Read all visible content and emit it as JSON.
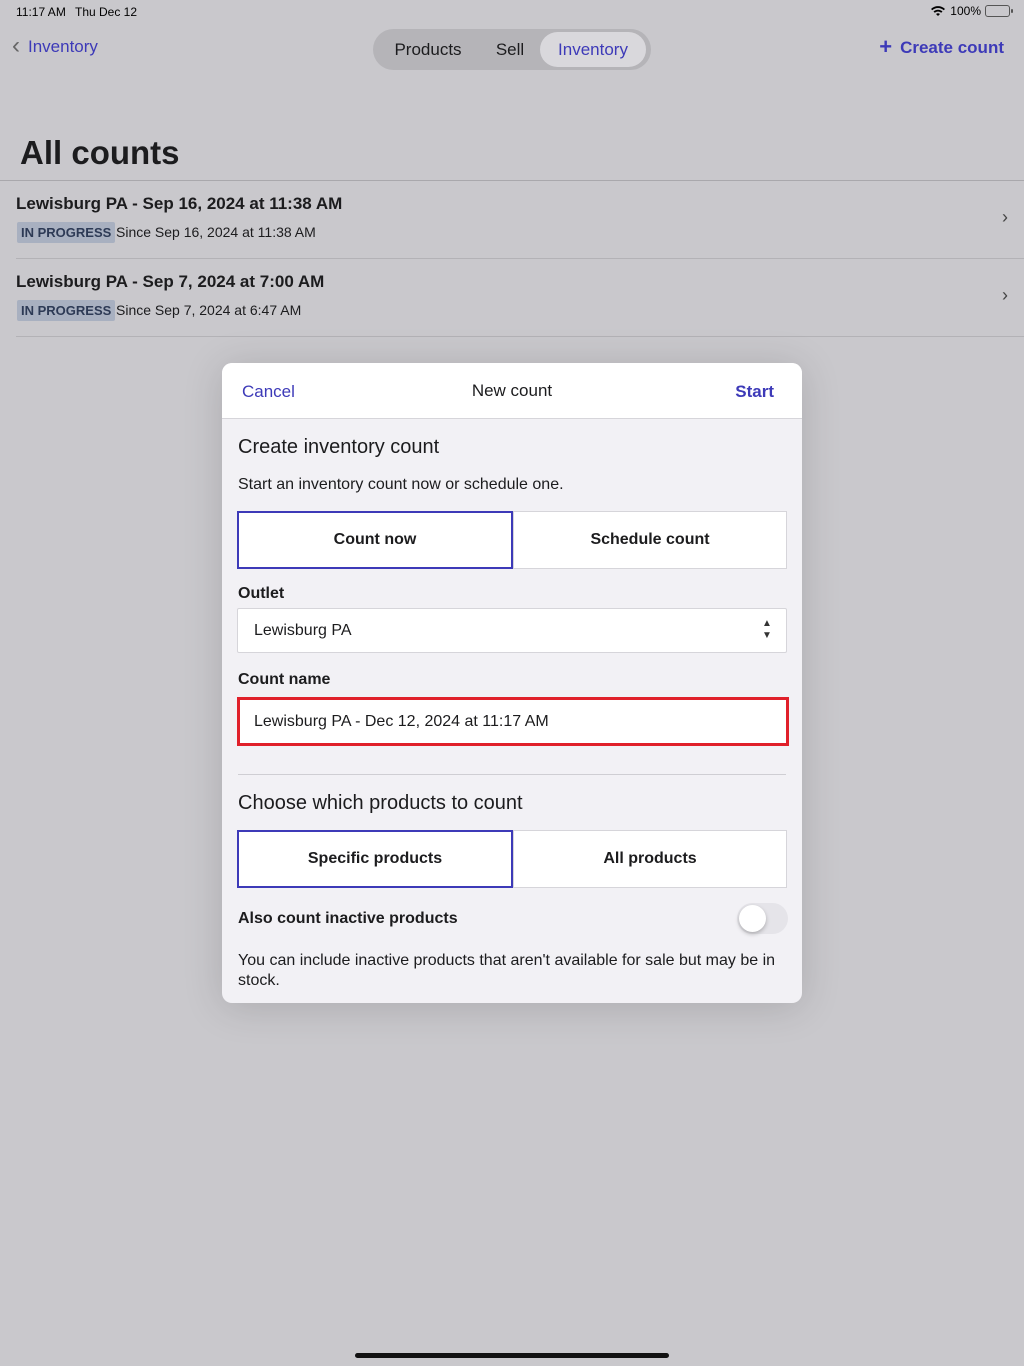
{
  "status_bar": {
    "time": "11:17 AM",
    "date": "Thu Dec 12",
    "battery": "100%",
    "wifi_icon": "wifi-icon",
    "battery_icon": "battery-charging-icon"
  },
  "nav": {
    "back_label": "Inventory",
    "tabs": [
      {
        "label": "Products",
        "active": false
      },
      {
        "label": "Sell",
        "active": false
      },
      {
        "label": "Inventory",
        "active": true
      }
    ],
    "create_label": "Create count"
  },
  "page": {
    "title": "All counts"
  },
  "counts": [
    {
      "title": "Lewisburg PA - Sep 16, 2024 at 11:38 AM",
      "status": "IN PROGRESS",
      "since": "Since Sep 16, 2024 at 11:38 AM"
    },
    {
      "title": "Lewisburg PA - Sep 7, 2024 at 7:00 AM",
      "status": "IN PROGRESS",
      "since": "Since Sep 7, 2024 at 6:47 AM"
    }
  ],
  "modal": {
    "cancel_label": "Cancel",
    "title": "New count",
    "start_label": "Start",
    "create_heading": "Create inventory count",
    "create_desc": "Start an inventory count now or schedule one.",
    "timing_options": [
      {
        "label": "Count now",
        "selected": true
      },
      {
        "label": "Schedule count",
        "selected": false
      }
    ],
    "outlet_label": "Outlet",
    "outlet_value": "Lewisburg PA",
    "count_name_label": "Count name",
    "count_name_value": "Lewisburg PA - Dec 12, 2024 at 11:17 AM",
    "products_heading": "Choose which products to count",
    "product_options": [
      {
        "label": "Specific products",
        "selected": true
      },
      {
        "label": "All products",
        "selected": false
      }
    ],
    "inactive_label": "Also count inactive products",
    "inactive_enabled": false,
    "inactive_help": "You can include inactive products that aren't available for sale but may be in stock."
  },
  "colors": {
    "accent": "#3d3ab8",
    "highlight_border": "#e0202a",
    "badge_bg": "#a8b0c0"
  }
}
